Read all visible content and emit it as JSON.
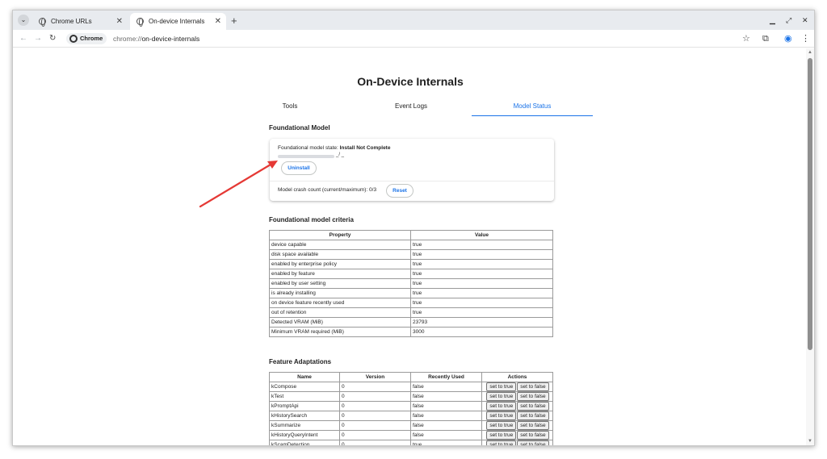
{
  "browser": {
    "tabs": [
      {
        "label": "Chrome URLs"
      },
      {
        "label": "On-device Internals"
      }
    ],
    "new_tab": "+",
    "chip_label": "Chrome",
    "url_scheme": "chrome://",
    "url_path": "on-device-internals"
  },
  "page": {
    "title": "On-Device Internals",
    "tabs": [
      {
        "label": "Tools"
      },
      {
        "label": "Event Logs"
      },
      {
        "label": "Model Status"
      }
    ],
    "active_tab": "Model Status"
  },
  "foundational": {
    "heading": "Foundational Model",
    "state_prefix": "Foundational model state:",
    "state_value": "Install Not Complete",
    "progress_fraction": 0.0,
    "progress_text": "_/ _",
    "uninstall_label": "Uninstall",
    "crash_text": "Model crash count (current/maximum): 0/3",
    "reset_label": "Reset"
  },
  "criteria": {
    "heading": "Foundational model criteria",
    "columns": [
      "Property",
      "Value"
    ],
    "rows": [
      [
        "device capable",
        "true"
      ],
      [
        "disk space available",
        "true"
      ],
      [
        "enabled by enterprise policy",
        "true"
      ],
      [
        "enabled by feature",
        "true"
      ],
      [
        "enabled by user setting",
        "true"
      ],
      [
        "is already installing",
        "true"
      ],
      [
        "on device feature recently used",
        "true"
      ],
      [
        "out of retention",
        "true"
      ],
      [
        "Detected VRAM (MiB)",
        "23793"
      ],
      [
        "Minimum VRAM required (MiB)",
        "3000"
      ]
    ]
  },
  "features": {
    "heading": "Feature Adaptations",
    "columns": [
      "Name",
      "Version",
      "Recently Used",
      "Actions"
    ],
    "set_true_label": "set to true",
    "set_false_label": "set to false",
    "rows": [
      [
        "kCompose",
        "0",
        "false"
      ],
      [
        "kTest",
        "0",
        "false"
      ],
      [
        "kPromptApi",
        "0",
        "false"
      ],
      [
        "kHistorySearch",
        "0",
        "false"
      ],
      [
        "kSummarize",
        "0",
        "false"
      ],
      [
        "kHistoryQueryIntent",
        "0",
        "false"
      ],
      [
        "kScamDetection",
        "0",
        "true"
      ]
    ]
  },
  "colors": {
    "accent": "#1a73e8",
    "annotation_arrow": "#e53935"
  },
  "icons": [
    "tab-search-icon",
    "globe-icon",
    "close-icon",
    "new-tab-icon",
    "back-icon",
    "forward-icon",
    "reload-icon",
    "chrome-icon",
    "bookmark-star-icon",
    "extensions-icon",
    "profile-icon",
    "menu-icon",
    "minimize-icon",
    "maximize-icon",
    "window-close-icon"
  ]
}
